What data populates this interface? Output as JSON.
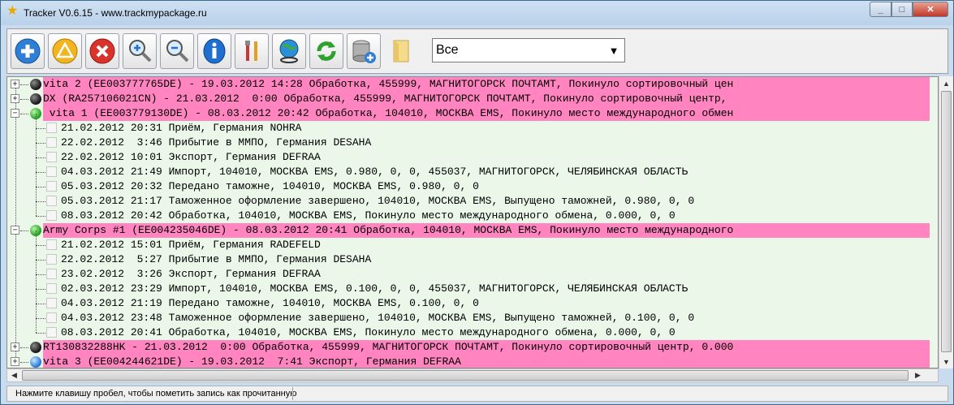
{
  "window": {
    "title": "Tracker V0.6.15 - www.trackmypackage.ru",
    "app_icon": "star-icon",
    "controls": {
      "minimize": "_",
      "maximize": "□",
      "close": "✕"
    }
  },
  "toolbar": {
    "buttons": [
      {
        "name": "add-icon"
      },
      {
        "name": "warning-icon"
      },
      {
        "name": "delete-icon"
      },
      {
        "name": "zoom-in-icon"
      },
      {
        "name": "zoom-out-icon"
      },
      {
        "name": "info-icon"
      },
      {
        "name": "tools-icon"
      },
      {
        "name": "globe-icon"
      },
      {
        "name": "refresh-icon"
      },
      {
        "name": "database-add-icon"
      },
      {
        "name": "folder-icon"
      }
    ],
    "filter": {
      "selected": "Все"
    }
  },
  "tree": {
    "rows": [
      {
        "kind": "parent",
        "status": "black",
        "expanded": false,
        "text": "vita 2 (EE003777765DE) - 19.03.2012 14:28 Обработка, 455999, МАГНИТОГОРСК ПОЧТАМТ, Покинуло сортировочный цен"
      },
      {
        "kind": "parent",
        "status": "black",
        "expanded": false,
        "text": "DX (RA257106021CN) - 21.03.2012  0:00 Обработка, 455999, МАГНИТОГОРСК ПОЧТАМТ, Покинуло сортировочный центр,"
      },
      {
        "kind": "parent",
        "status": "green",
        "expanded": true,
        "text": " vita 1 (EE003779130DE) - 08.03.2012 20:42 Обработка, 104010, МОСКВА EMS, Покинуло место международного обмен"
      },
      {
        "kind": "child",
        "text": "21.02.2012 20:31 Приём, Германия NOHRA"
      },
      {
        "kind": "child",
        "text": "22.02.2012  3:46 Прибытие в ММПО, Германия DESAHA"
      },
      {
        "kind": "child",
        "text": "22.02.2012 10:01 Экспорт, Германия DEFRAA"
      },
      {
        "kind": "child",
        "text": "04.03.2012 21:49 Импорт, 104010, МОСКВА EMS, 0.980, 0, 0, 455037, МАГНИТОГОРСК, ЧЕЛЯБИНСКАЯ ОБЛАСТЬ"
      },
      {
        "kind": "child",
        "text": "05.03.2012 20:32 Передано таможне, 104010, МОСКВА EMS, 0.980, 0, 0"
      },
      {
        "kind": "child",
        "text": "05.03.2012 21:17 Таможенное оформление завершено, 104010, МОСКВА EMS, Выпущено таможней, 0.980, 0, 0"
      },
      {
        "kind": "child",
        "text": "08.03.2012 20:42 Обработка, 104010, МОСКВА EMS, Покинуло место международного обмена, 0.000, 0, 0"
      },
      {
        "kind": "parent",
        "status": "green",
        "expanded": true,
        "text": "Army Corps #1 (EE004235046DE) - 08.03.2012 20:41 Обработка, 104010, МОСКВА EMS, Покинуло место международного"
      },
      {
        "kind": "child",
        "text": "21.02.2012 15:01 Приём, Германия RADEFELD"
      },
      {
        "kind": "child",
        "text": "22.02.2012  5:27 Прибытие в ММПО, Германия DESAHA"
      },
      {
        "kind": "child",
        "text": "23.02.2012  3:26 Экспорт, Германия DEFRAA"
      },
      {
        "kind": "child",
        "text": "02.03.2012 23:29 Импорт, 104010, МОСКВА EMS, 0.100, 0, 0, 455037, МАГНИТОГОРСК, ЧЕЛЯБИНСКАЯ ОБЛАСТЬ"
      },
      {
        "kind": "child",
        "text": "04.03.2012 21:19 Передано таможне, 104010, МОСКВА EMS, 0.100, 0, 0"
      },
      {
        "kind": "child",
        "text": "04.03.2012 23:48 Таможенное оформление завершено, 104010, МОСКВА EMS, Выпущено таможней, 0.100, 0, 0"
      },
      {
        "kind": "child",
        "text": "08.03.2012 20:41 Обработка, 104010, МОСКВА EMS, Покинуло место международного обмена, 0.000, 0, 0"
      },
      {
        "kind": "parent",
        "status": "black",
        "expanded": false,
        "text": "RT130832288HK - 21.03.2012  0:00 Обработка, 455999, МАГНИТОГОРСК ПОЧТАМТ, Покинуло сортировочный центр, 0.000"
      },
      {
        "kind": "parent",
        "status": "blue",
        "expanded": false,
        "text": "vita 3 (EE004244621DE) - 19.03.2012  7:41 Экспорт, Германия DEFRAA"
      }
    ]
  },
  "statusbar": {
    "text": "Нажмите клавишу пробел, чтобы пометить запись как прочитанную"
  }
}
